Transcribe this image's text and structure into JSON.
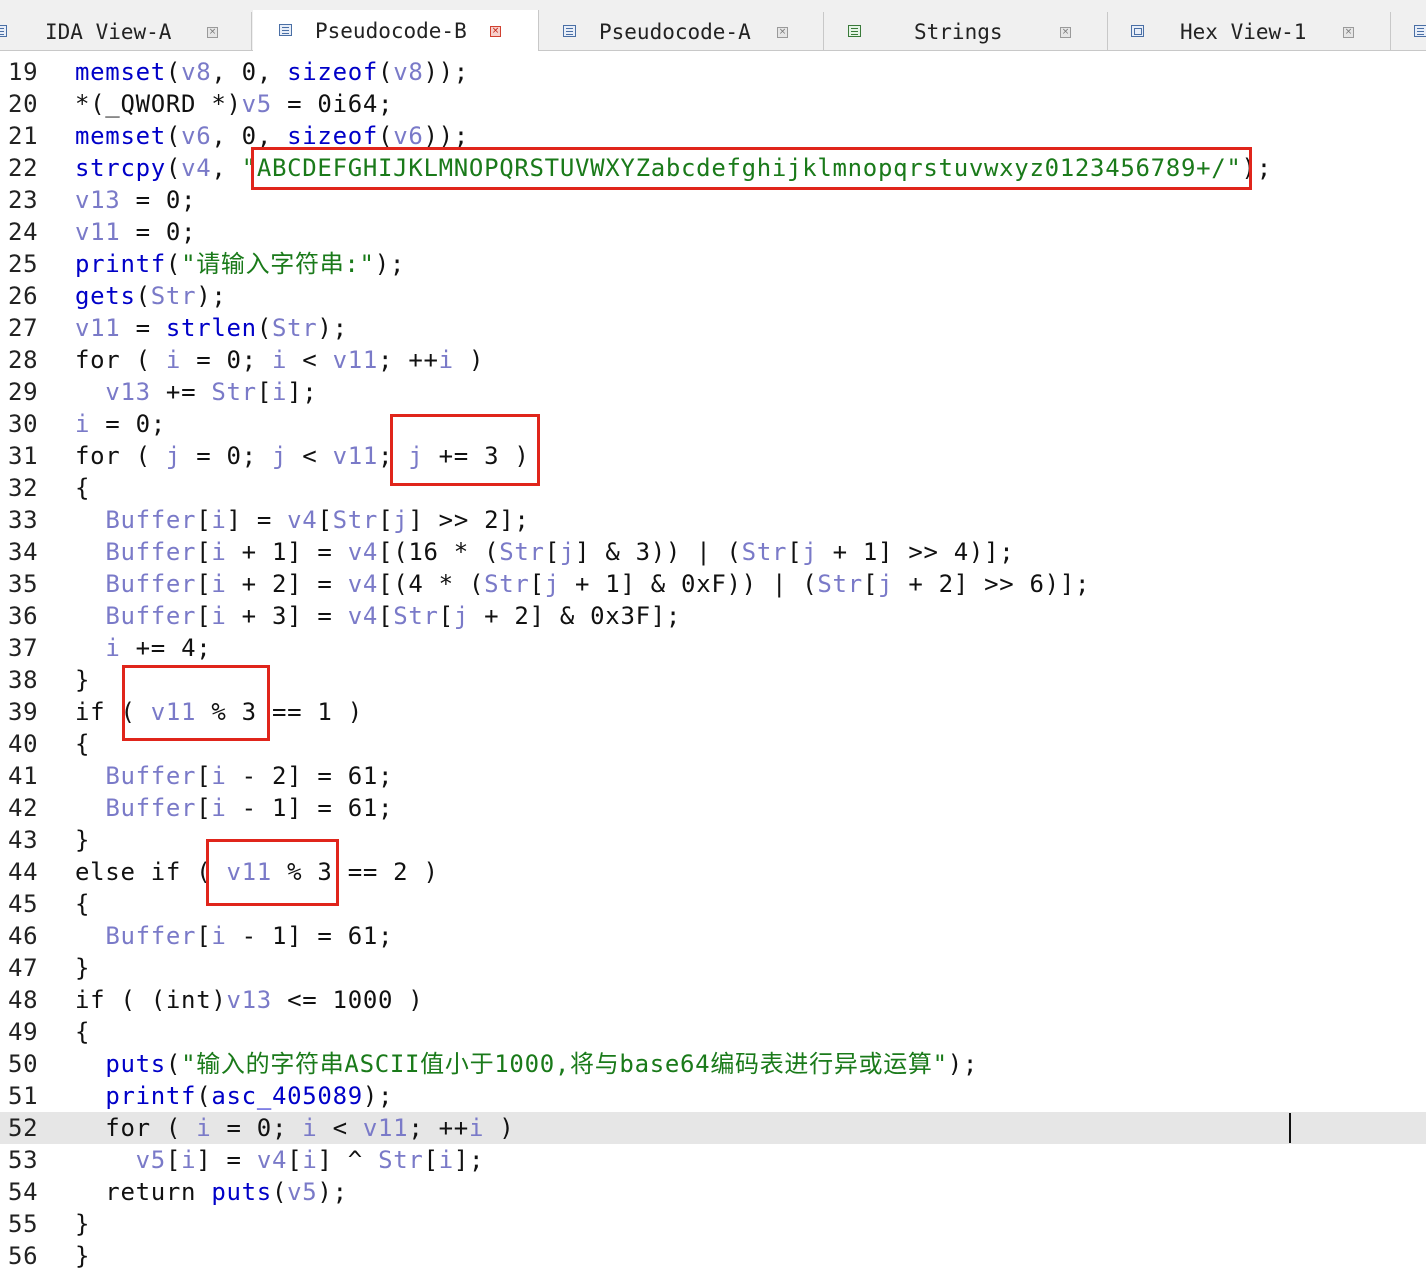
{
  "tabs": [
    {
      "label": "IDA View-A",
      "icon": "listing-icon",
      "active": false
    },
    {
      "label": "Pseudocode-B",
      "icon": "pseudocode-icon",
      "active": true
    },
    {
      "label": "Pseudocode-A",
      "icon": "pseudocode-icon",
      "active": false
    },
    {
      "label": "Strings",
      "icon": "strings-icon",
      "active": false
    },
    {
      "label": "Hex View-1",
      "icon": "hex-icon",
      "active": false
    }
  ],
  "code": {
    "lines": [
      {
        "n": "19",
        "t": "memset(v8, 0, sizeof(v8));"
      },
      {
        "n": "20",
        "t": "*(_QWORD *)v5 = 0i64;"
      },
      {
        "n": "21",
        "t": "memset(v6, 0, sizeof(v6));"
      },
      {
        "n": "22",
        "t": "strcpy(v4, \"ABCDEFGHIJKLMNOPQRSTUVWXYZabcdefghijklmnopqrstuvwxyz0123456789+/\");"
      },
      {
        "n": "23",
        "t": "v13 = 0;"
      },
      {
        "n": "24",
        "t": "v11 = 0;"
      },
      {
        "n": "25",
        "t": "printf(\"请输入字符串:\");"
      },
      {
        "n": "26",
        "t": "gets(Str);"
      },
      {
        "n": "27",
        "t": "v11 = strlen(Str);"
      },
      {
        "n": "28",
        "t": "for ( i = 0; i < v11; ++i )"
      },
      {
        "n": "29",
        "t": "  v13 += Str[i];"
      },
      {
        "n": "30",
        "t": "i = 0;"
      },
      {
        "n": "31",
        "t": "for ( j = 0; j < v11; j += 3 )"
      },
      {
        "n": "32",
        "t": "{"
      },
      {
        "n": "33",
        "t": "  Buffer[i] = v4[Str[j] >> 2];"
      },
      {
        "n": "34",
        "t": "  Buffer[i + 1] = v4[(16 * (Str[j] & 3)) | (Str[j + 1] >> 4)];"
      },
      {
        "n": "35",
        "t": "  Buffer[i + 2] = v4[(4 * (Str[j + 1] & 0xF)) | (Str[j + 2] >> 6)];"
      },
      {
        "n": "36",
        "t": "  Buffer[i + 3] = v4[Str[j + 2] & 0x3F];"
      },
      {
        "n": "37",
        "t": "  i += 4;"
      },
      {
        "n": "38",
        "t": "}"
      },
      {
        "n": "39",
        "t": "if ( v11 % 3 == 1 )"
      },
      {
        "n": "40",
        "t": "{"
      },
      {
        "n": "41",
        "t": "  Buffer[i - 2] = 61;"
      },
      {
        "n": "42",
        "t": "  Buffer[i - 1] = 61;"
      },
      {
        "n": "43",
        "t": "}"
      },
      {
        "n": "44",
        "t": "else if ( v11 % 3 == 2 )"
      },
      {
        "n": "45",
        "t": "{"
      },
      {
        "n": "46",
        "t": "  Buffer[i - 1] = 61;"
      },
      {
        "n": "47",
        "t": "}"
      },
      {
        "n": "48",
        "t": "if ( (int)v13 <= 1000 )"
      },
      {
        "n": "49",
        "t": "{"
      },
      {
        "n": "50",
        "t": "  puts(\"输入的字符串ASCII值小于1000,将与base64编码表进行异或运算\");"
      },
      {
        "n": "51",
        "t": "  printf(asc_405089);"
      },
      {
        "n": "52",
        "t": "  for ( i = 0; i < v11; ++i )"
      },
      {
        "n": "53",
        "t": "    v5[i] = v4[i] ^ Str[i];"
      },
      {
        "n": "54",
        "t": "  return puts(v5);"
      },
      {
        "n": "55",
        "t": "}"
      },
      {
        "n": "56",
        "t": "}"
      }
    ],
    "highlighted_line": "52",
    "annotation_color": "#e0251b"
  },
  "syntax_colors": {
    "function": "#0000c8",
    "variable": "#7a7ac8",
    "string": "#1a7a1a",
    "text": "#111111"
  }
}
